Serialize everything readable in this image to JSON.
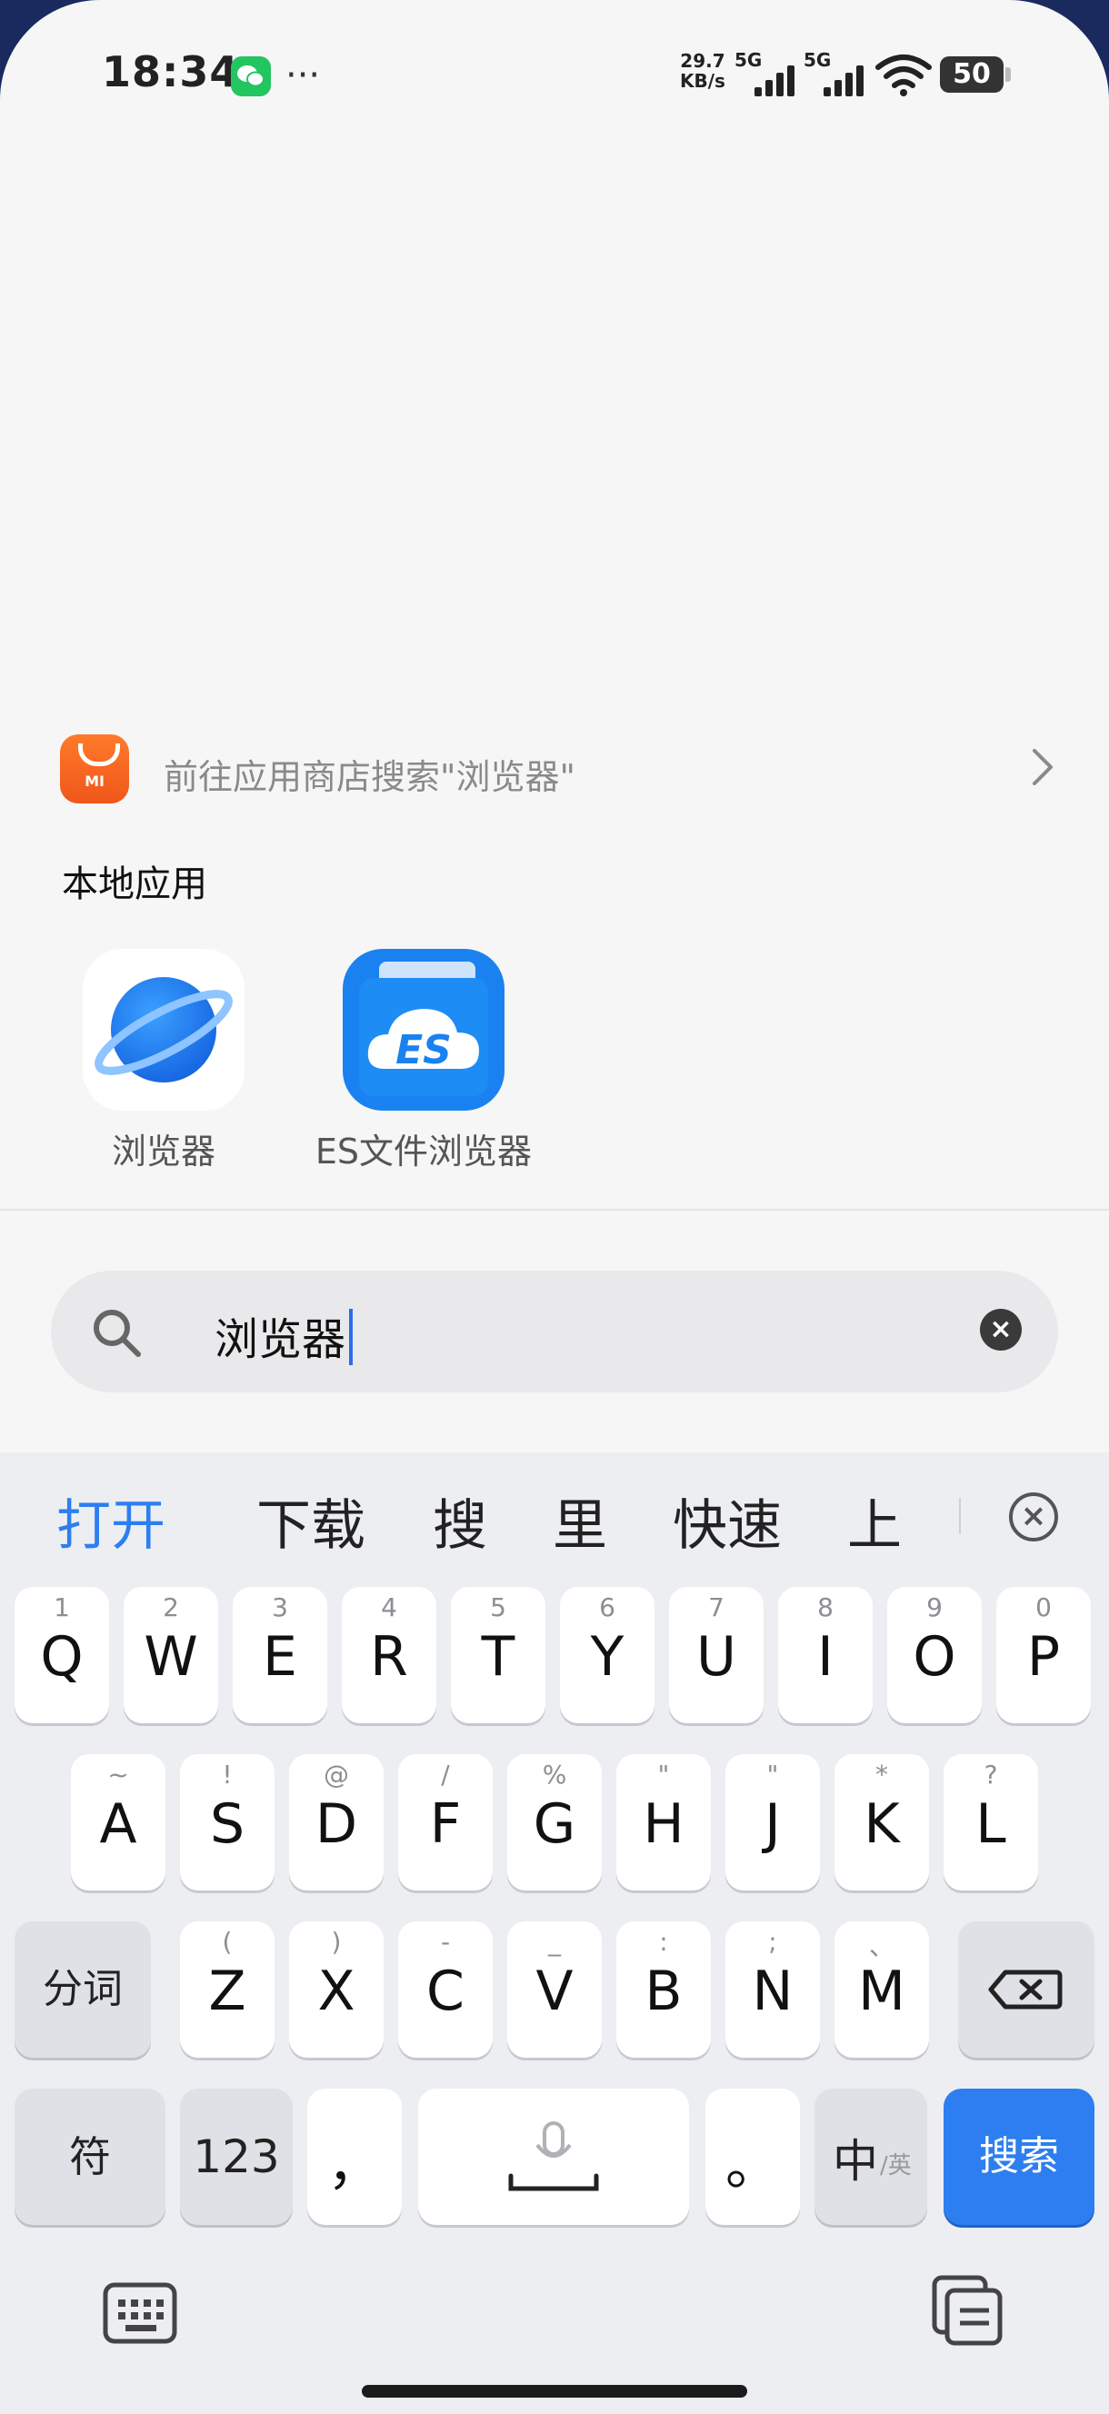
{
  "status_bar": {
    "time": "18:34",
    "net_speed_value": "29.7",
    "net_speed_unit": "KB/s",
    "sim1_label": "5G",
    "sim2_label": "5G",
    "battery": "50",
    "more": "···"
  },
  "store_search": {
    "text": "前往应用商店搜索\"浏览器\"",
    "icon_letters": "MI"
  },
  "local_apps": {
    "title": "本地应用",
    "items": [
      {
        "name": "浏览器"
      },
      {
        "name": "ES文件浏览器",
        "icon_letters": "ES"
      }
    ]
  },
  "search": {
    "value": "浏览器"
  },
  "keyboard": {
    "candidates": [
      "打开",
      "下载",
      "搜",
      "里",
      "快速",
      "上"
    ],
    "row1": [
      {
        "main": "Q",
        "hint": "1"
      },
      {
        "main": "W",
        "hint": "2"
      },
      {
        "main": "E",
        "hint": "3"
      },
      {
        "main": "R",
        "hint": "4"
      },
      {
        "main": "T",
        "hint": "5"
      },
      {
        "main": "Y",
        "hint": "6"
      },
      {
        "main": "U",
        "hint": "7"
      },
      {
        "main": "I",
        "hint": "8"
      },
      {
        "main": "O",
        "hint": "9"
      },
      {
        "main": "P",
        "hint": "0"
      }
    ],
    "row2": [
      {
        "main": "A",
        "hint": "~"
      },
      {
        "main": "S",
        "hint": "!"
      },
      {
        "main": "D",
        "hint": "@"
      },
      {
        "main": "F",
        "hint": "/"
      },
      {
        "main": "G",
        "hint": "%"
      },
      {
        "main": "H",
        "hint": "\""
      },
      {
        "main": "J",
        "hint": "\""
      },
      {
        "main": "K",
        "hint": "*"
      },
      {
        "main": "L",
        "hint": "?"
      }
    ],
    "row3": [
      {
        "main": "Z",
        "hint": "("
      },
      {
        "main": "X",
        "hint": ")"
      },
      {
        "main": "C",
        "hint": "-"
      },
      {
        "main": "V",
        "hint": "_"
      },
      {
        "main": "B",
        "hint": ":"
      },
      {
        "main": "N",
        "hint": ";"
      },
      {
        "main": "M",
        "hint": "、"
      }
    ],
    "fenci": "分词",
    "fu": "符",
    "num": "123",
    "comma": "，",
    "period": "。",
    "lang_main": "中",
    "lang_sub": "/英",
    "search_btn": "搜索"
  },
  "colors": {
    "accent": "#2d7ef0",
    "store": "#f0561a"
  }
}
